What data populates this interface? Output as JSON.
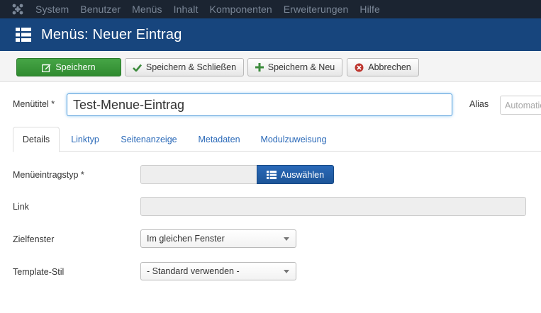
{
  "topnav": {
    "logo_icon": "joomla-logo-icon",
    "items": [
      "System",
      "Benutzer",
      "Menüs",
      "Inhalt",
      "Komponenten",
      "Erweiterungen",
      "Hilfe"
    ]
  },
  "titlebar": {
    "icon": "menu-list-icon",
    "title": "Menüs: Neuer Eintrag"
  },
  "toolbar": {
    "save_label": "Speichern",
    "save_close_label": "Speichern & Schließen",
    "save_new_label": "Speichern & Neu",
    "cancel_label": "Abbrechen"
  },
  "form": {
    "menu_title_label": "Menütitel *",
    "menu_title_value": "Test-Menue-Eintrag",
    "alias_label": "Alias",
    "alias_placeholder": "Automatic"
  },
  "tabs": [
    "Details",
    "Linktyp",
    "Seitenanzeige",
    "Metadaten",
    "Modulzuweisung"
  ],
  "details": {
    "item_type_label": "Menüeintragstyp *",
    "select_button_label": "Auswählen",
    "link_label": "Link",
    "target_window_label": "Zielfenster",
    "target_window_value": "Im gleichen Fenster",
    "template_style_label": "Template-Stil",
    "template_style_value": "- Standard verwenden -"
  },
  "colors": {
    "topnav_bg": "#1b2431",
    "titlebar_bg": "#17457d",
    "save_green": "#3c9a3c",
    "primary_blue": "#2a69b8",
    "link_blue": "#2a69b8"
  }
}
